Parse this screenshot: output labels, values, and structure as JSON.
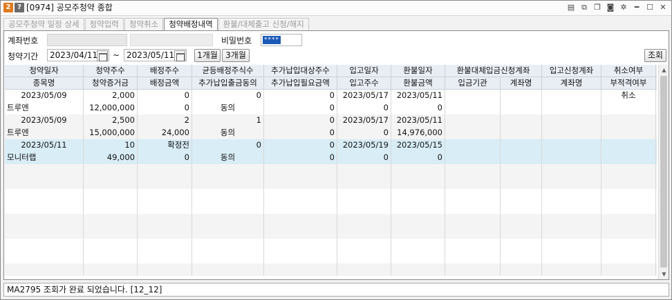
{
  "window": {
    "badge_num": "2",
    "badge_help": "?",
    "title": "[0974] 공모주청약 종합"
  },
  "tabs": [
    {
      "label": "공모주청약 일정 상세",
      "active": false
    },
    {
      "label": "청약입력",
      "active": false
    },
    {
      "label": "청약취소",
      "active": false
    },
    {
      "label": "청약배정내역",
      "active": true
    },
    {
      "label": "환불/대체출고 신청/해지",
      "active": false
    }
  ],
  "form": {
    "account_label": "계좌번호",
    "password_label": "비밀번호",
    "password_mask": "****",
    "period_label": "청약기간",
    "date_from": "2023/04/11",
    "tilde": "~",
    "date_to": "2023/05/11",
    "one_month": "1개월",
    "three_month": "3개월",
    "query": "조회"
  },
  "columns_row1": [
    "청약일자",
    "청약주수",
    "배정주수",
    "균등배정주식수",
    "추가납입대상주수",
    "입고일자",
    "환불일자",
    "환불대체입금신청계좌",
    "입고신청계좌",
    "취소여부"
  ],
  "columns_row2": [
    "종목명",
    "청약증거금",
    "배정금액",
    "추가납입출금동의",
    "추가납입필요금액",
    "입고주수",
    "환불금액",
    "입금기관",
    "계좌명",
    "계좌명",
    "부적격여부"
  ],
  "records": [
    {
      "line1": [
        "2023/05/09",
        "2,000",
        "0",
        "0",
        "0",
        "2023/05/17",
        "2023/05/11",
        "",
        "",
        "",
        "취소"
      ],
      "line2": [
        "트루엔",
        "12,000,000",
        "0",
        "동의",
        "0",
        "0",
        "0",
        "",
        "",
        "",
        ""
      ],
      "highlight": false
    },
    {
      "line1": [
        "2023/05/09",
        "2,500",
        "2",
        "1",
        "0",
        "2023/05/17",
        "2023/05/11",
        "",
        "",
        "",
        ""
      ],
      "line2": [
        "트루엔",
        "15,000,000",
        "24,000",
        "동의",
        "0",
        "0",
        "14,976,000",
        "",
        "",
        "",
        ""
      ],
      "highlight": false
    },
    {
      "line1": [
        "2023/05/11",
        "10",
        "확정전",
        "0",
        "0",
        "2023/05/19",
        "2023/05/15",
        "",
        "",
        "",
        ""
      ],
      "line2": [
        "모니터랩",
        "49,000",
        "0",
        "동의",
        "0",
        "0",
        "0",
        "",
        "",
        "",
        ""
      ],
      "highlight": true
    }
  ],
  "status_message": "MA2795 조회가 완료 되었습니다. [12_12]",
  "colors": {
    "highlight_row": "#d8edf6",
    "alt_row": "#f4f4f4",
    "header_bg": "#e9eef5",
    "password_bg": "#1a59b8"
  }
}
